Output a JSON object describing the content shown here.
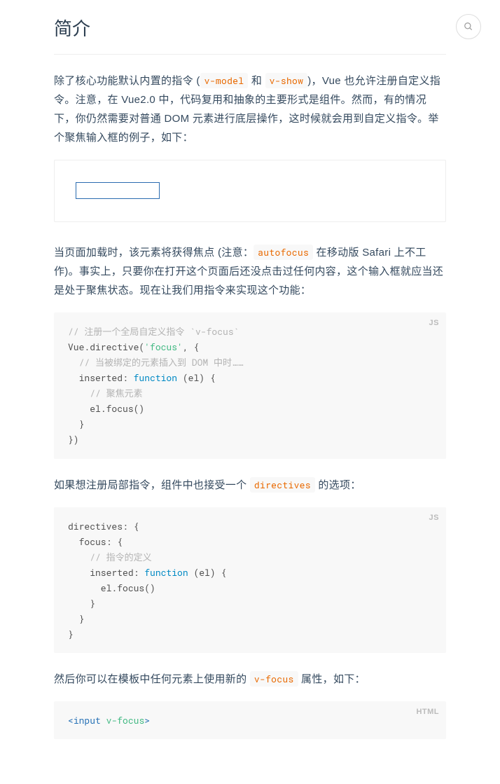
{
  "header": {
    "title": "简介"
  },
  "search": {
    "placeholder": ""
  },
  "content": {
    "p1_a": "除了核心功能默认内置的指令 (",
    "p1_code1": "v-model",
    "p1_b": " 和 ",
    "p1_code2": "v-show",
    "p1_c": ")，Vue 也允许注册自定义指令。注意，在 Vue2.0 中，代码复用和抽象的主要形式是组件。然而，有的情况下，你仍然需要对普通 DOM 元素进行底层操作，这时候就会用到自定义指令。举个聚焦输入框的例子，如下：",
    "p2_a": "当页面加载时，该元素将获得焦点 (注意：",
    "p2_code1": "autofocus",
    "p2_b": " 在移动版 Safari 上不工作)。事实上，只要你在打开这个页面后还没点击过任何内容，这个输入框就应当还是处于聚焦状态。现在让我们用指令来实现这个功能：",
    "p3_a": "如果想注册局部指令，组件中也接受一个 ",
    "p3_code1": "directives",
    "p3_b": " 的选项：",
    "p4_a": "然后你可以在模板中任何元素上使用新的 ",
    "p4_code1": "v-focus",
    "p4_b": " 属性，如下："
  },
  "code1": {
    "lang": "JS",
    "c1": "// 注册一个全局自定义指令 `v-focus`",
    "l2a": "Vue.directive(",
    "l2s": "'focus'",
    "l2b": ", {",
    "c2": "  // 当被绑定的元素插入到 DOM 中时……",
    "l4a": "  inserted: ",
    "l4k": "function",
    "l4b": " (el) {",
    "c3": "    // 聚焦元素",
    "l6": "    el.focus()",
    "l7": "  }",
    "l8": "})"
  },
  "code2": {
    "lang": "JS",
    "l1": "directives: {",
    "l2": "  focus: {",
    "c1": "    // 指令的定义",
    "l4a": "    inserted: ",
    "l4k": "function",
    "l4b": " (el) {",
    "l5": "      el.focus()",
    "l6": "    }",
    "l7": "  }",
    "l8": "}"
  },
  "code3": {
    "lang": "HTML",
    "l1a": "<",
    "l1tag": "input",
    "l1sp": " ",
    "l1attr": "v-focus",
    "l1b": ">"
  }
}
